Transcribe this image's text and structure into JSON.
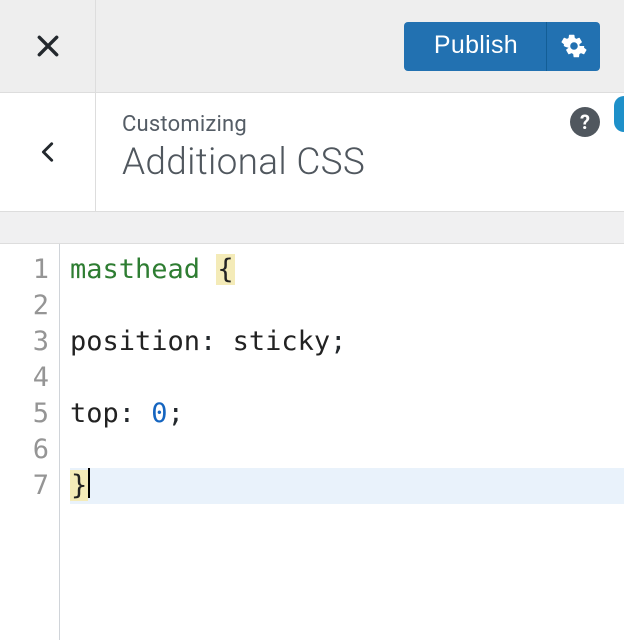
{
  "topbar": {
    "publish_label": "Publish"
  },
  "header": {
    "subtitle": "Customizing",
    "title": "Additional CSS",
    "help_glyph": "?"
  },
  "editor": {
    "line_numbers": [
      "1",
      "2",
      "3",
      "4",
      "5",
      "6",
      "7"
    ],
    "lines": {
      "l1_selector": "masthead",
      "l1_brace": "{",
      "l3_prop": "position",
      "l3_colon": ": ",
      "l3_value": "sticky",
      "l3_semi": ";",
      "l5_prop": "top",
      "l5_colon": ": ",
      "l5_value": "0",
      "l5_semi": ";",
      "l7_brace": "}"
    }
  }
}
